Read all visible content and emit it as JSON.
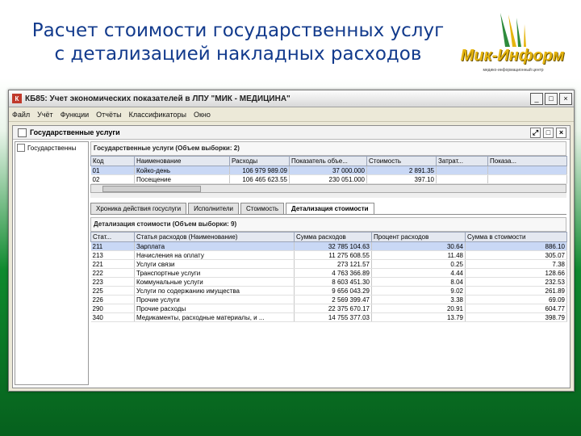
{
  "slide": {
    "title_line1": "Расчет стоимости государственных услуг",
    "title_line2": "с детализацией накладных расходов",
    "logo_text": "Мик-Информ",
    "logo_subtext": "медико-информационный центр"
  },
  "window": {
    "app_icon": "К",
    "title": "КБ85: Учет экономических показателей в ЛПУ \"МИК - МЕДИЦИНА\"",
    "btn_min": "_",
    "btn_max": "□",
    "btn_close": "×"
  },
  "menu": [
    "Файл",
    "Учёт",
    "Функции",
    "Отчёты",
    "Классификаторы",
    "Окно"
  ],
  "inner": {
    "title": "Государственные услуги",
    "btn_restore": "⤢",
    "btn_max": "□",
    "btn_close": "×"
  },
  "tree": {
    "item": "Государственны"
  },
  "top_panel": {
    "title": "Государственные услуги (Объем выборки: 2)",
    "columns": [
      "Код",
      "Наименование",
      "Расходы",
      "Показатель объе...",
      "Стоимость",
      "Затрат...",
      "Показа..."
    ],
    "rows": [
      [
        "01",
        "Койко-день",
        "106 979 989.09",
        "37 000.000",
        "2 891.35",
        "",
        ""
      ],
      [
        "02",
        "Посещение",
        "106 465 623.55",
        "230 051.000",
        "397.10",
        "",
        ""
      ]
    ]
  },
  "tabs": [
    "Хроника действия госуслуги",
    "Исполнители",
    "Стоимость",
    "Детализация стоимости"
  ],
  "detail_panel": {
    "title": "Детализация стоимости (Объем выборки: 9)",
    "columns": [
      "Стат...",
      "Статья расходов (Наименование)",
      "Сумма расходов",
      "Процент расходов",
      "Сумма в стоимости"
    ],
    "rows": [
      [
        "211",
        "Зарплата",
        "32 785 104.63",
        "30.64",
        "886.10"
      ],
      [
        "213",
        "Начисления на оплату",
        "11 275 608.55",
        "11.48",
        "305.07"
      ],
      [
        "221",
        "Услуги связи",
        "273 121.57",
        "0.25",
        "7.38"
      ],
      [
        "222",
        "Транспортные услуги",
        "4 763 366.89",
        "4.44",
        "128.66"
      ],
      [
        "223",
        "Коммунальные услуги",
        "8 603 451.30",
        "8.04",
        "232.53"
      ],
      [
        "225",
        "Услуги по содержанию имущества",
        "9 656 043.29",
        "9.02",
        "261.89"
      ],
      [
        "226",
        "Прочие услуги",
        "2 569 399.47",
        "3.38",
        "69.09"
      ],
      [
        "290",
        "Прочие расходы",
        "22 375 670.17",
        "20.91",
        "604.77"
      ],
      [
        "340",
        "Медикаменты, расходные материалы, и ...",
        "14 755 377.03",
        "13.79",
        "398.79"
      ]
    ]
  }
}
